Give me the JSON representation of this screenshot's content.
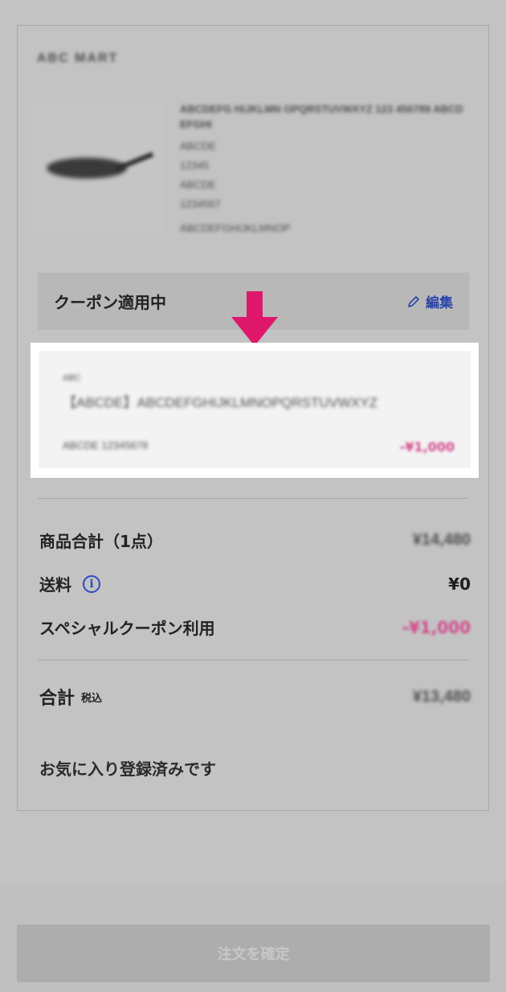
{
  "shop": {
    "name": "ABC MART"
  },
  "product": {
    "title": "ABCDEFG HIJKLMN OPQRSTUVWXYZ 123 456789 ABCD EFGHI",
    "meta": [
      "ABCDE",
      "12345",
      "ABCDE",
      "1234567"
    ],
    "lower": "ABCDEFGHIJKLMNOP"
  },
  "coupon_bar": {
    "label": "クーポン適用中",
    "edit": "編集",
    "icon": "pencil-icon"
  },
  "coupon_card": {
    "tag": "ABC",
    "name": "【ABCDE】ABCDEFGHIJKLMNOPQRSTUVWXYZ",
    "date": "ABCDE 12345678",
    "amount": "-¥1,000"
  },
  "summary": {
    "subtotal_label": "商品合計（1点）",
    "subtotal_value": "¥14,480",
    "shipping_label": "送料",
    "shipping_value": "¥0",
    "coupon_label": "スペシャルクーポン利用",
    "coupon_value": "-¥1,000",
    "total_label": "合計",
    "tax_label": "税込",
    "total_value": "¥13,480"
  },
  "favorite_text": "お気に入り登録済みです",
  "order_button": "注文を確定",
  "colors": {
    "accent_pink": "#d24c8c",
    "link_blue": "#2a44a8",
    "arrow": "#e0186c"
  }
}
